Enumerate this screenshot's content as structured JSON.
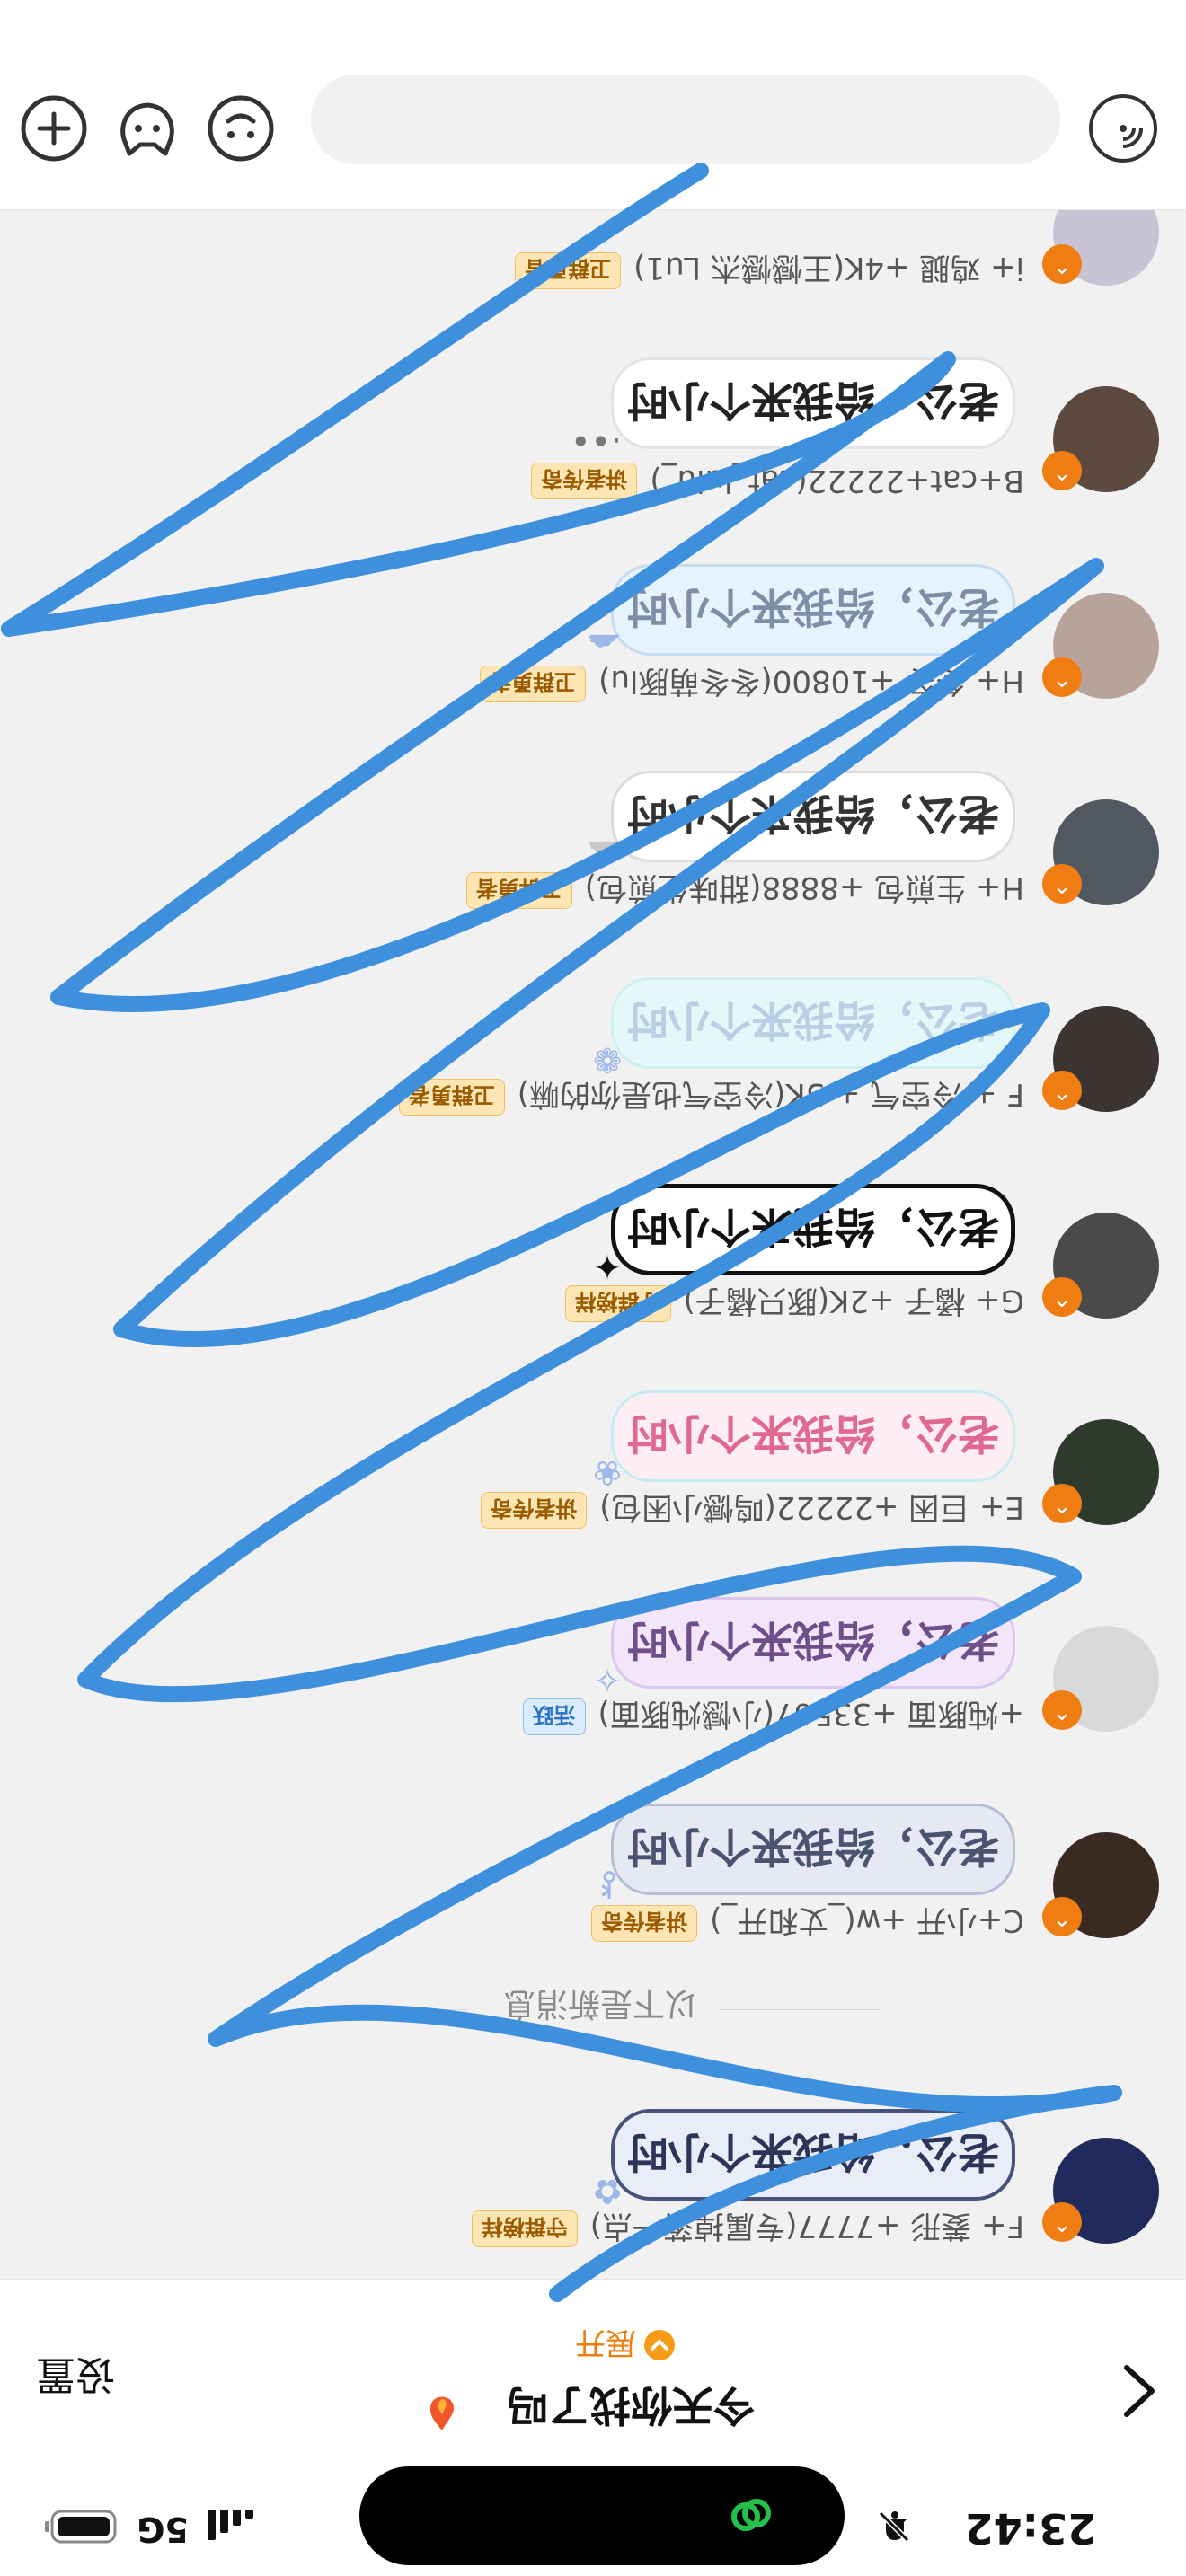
{
  "status_bar": {
    "time": "23:42",
    "network": "5G"
  },
  "header": {
    "title": "今天你找了吗",
    "expand_label": "展开",
    "settings_label": "设置"
  },
  "divider": {
    "label": "以下是新消息"
  },
  "messages": [
    {
      "sender": "F+ 菱形 +7777(专属掉落一点)",
      "badge": "守群榜样",
      "text": "老公，给我来个小时",
      "bubble_bg": "#e9edf8",
      "bubble_border": "#45527a",
      "text_color": "#2a3558",
      "badge_style": "orange"
    },
    {
      "sender": "C+小开 +w(_丈和开_)",
      "badge": "讲者传奇",
      "text": "老公，给我来个小时",
      "bubble_bg": "#e6e9f3",
      "bubble_border": "#b6bed6",
      "text_color": "#4a5470",
      "badge_style": "orange"
    },
    {
      "sender": "+炖豚面 +33567(小憾炖豚面)",
      "badge": "活跃",
      "text": "老公，给我来个小时",
      "bubble_bg": "#f3e6fb",
      "bubble_border": "#dcc6ef",
      "text_color": "#6f4f8a",
      "badge_style": "blue"
    },
    {
      "sender": "E+ 巨困 +22222(鸣憾小困包)",
      "badge": "讲者传奇",
      "text": "老公，给我来个小时",
      "bubble_bg": "#fdeef3",
      "bubble_border": "#c6ecf2",
      "text_color": "#e06a8f",
      "badge_style": "orange"
    },
    {
      "sender": "G+ 橘子 +2K(豚只橘子)",
      "badge": "守群榜样",
      "text": "老公，给我来个小时",
      "bubble_bg": "#ffffff",
      "bubble_border": "#111111",
      "text_color": "#111111",
      "badge_style": "orange"
    },
    {
      "sender": "F + 冷空气 + 5K(冷空气也是你的嘛)",
      "badge": "卫群勇者",
      "text": "老公，给我来个小时",
      "bubble_bg": "#e4f8f9",
      "bubble_border": "#cdeff2",
      "text_color": "#b9cfe3",
      "badge_style": "orange"
    },
    {
      "sender": "H+ 生煎包 +8888(甜味生煎包)",
      "badge": "卫群勇者",
      "text": "老公，给我来个小时",
      "bubble_bg": "#ffffff",
      "bubble_border": "#dcdcdc",
      "text_color": "#333333",
      "badge_style": "orange"
    },
    {
      "sender": "H+ 冬冬 +10800(冬冬萌豚lu)",
      "badge": "卫群勇者",
      "text": "老公，给我来个小时",
      "bubble_bg": "#e6f2fc",
      "bubble_border": "#c5dcf2",
      "text_color": "#7c8fa6",
      "badge_style": "orange"
    },
    {
      "sender": "B+cat+22222(cat_luiu_)",
      "badge": "讲者传奇",
      "text": "老公，给我来个小时",
      "bubble_bg": "#ffffff",
      "bubble_border": "#e3e3e3",
      "text_color": "#222222",
      "badge_style": "orange"
    },
    {
      "sender": "i+ 鸡腿 +4K(王憾憾杰 Lu1)",
      "badge": "卫群勇者",
      "text": "",
      "bubble_bg": "#f1f1f2",
      "bubble_border": "#f1f1f2",
      "text_color": "#222222",
      "badge_style": "orange"
    }
  ],
  "input": {
    "placeholder": ""
  },
  "colors": {
    "accent": "#f07d12",
    "scribble": "#3e8fdc"
  }
}
